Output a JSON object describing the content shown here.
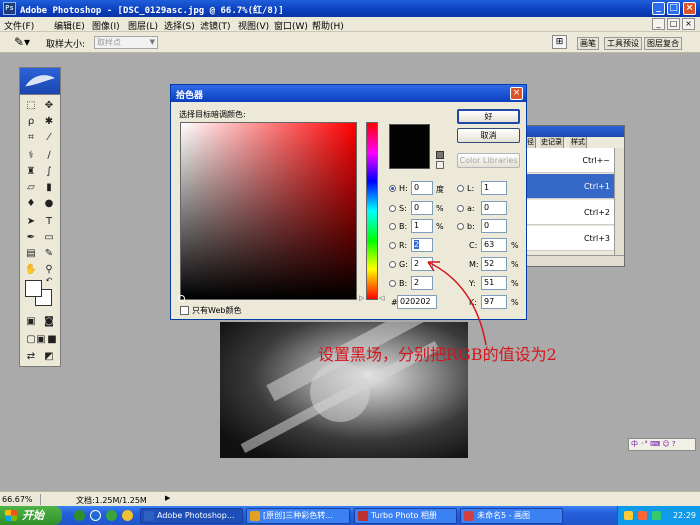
{
  "window": {
    "title": "Adobe Photoshop - [DSC_0129asc.jpg @ 66.7%(红/8)]",
    "app_icon": "Ps",
    "buttons": {
      "minimize": "_",
      "maximize": "□",
      "close": "×"
    }
  },
  "menubar": {
    "items": [
      "文件(F)",
      "编辑(E)",
      "图像(I)",
      "图层(L)",
      "选择(S)",
      "滤镜(T)",
      "视图(V)",
      "窗口(W)",
      "帮助(H)"
    ],
    "doc_buttons": [
      "_",
      "□",
      "×"
    ]
  },
  "options": {
    "tool_icon": "eyedropper-icon",
    "sample_size_label": "取样大小:",
    "sample_size_value": "取样点",
    "palette_tabs": [
      "画笔",
      "工具预设",
      "图层复合"
    ]
  },
  "color_picker": {
    "title": "拾色器",
    "prompt": "选择目标暗调颜色:",
    "buttons": {
      "ok": "好",
      "cancel": "取消",
      "libraries": "Color Libraries"
    },
    "hsb": [
      {
        "label": "H:",
        "value": "0",
        "unit": "度",
        "checked": true
      },
      {
        "label": "S:",
        "value": "0",
        "unit": "%",
        "checked": false
      },
      {
        "label": "B:",
        "value": "1",
        "unit": "%",
        "checked": false
      }
    ],
    "rgb": [
      {
        "label": "R:",
        "value": "2",
        "checked": false,
        "selected": true
      },
      {
        "label": "G:",
        "value": "2",
        "checked": false,
        "selected": false
      },
      {
        "label": "B:",
        "value": "2",
        "checked": false,
        "selected": false
      }
    ],
    "lab": [
      {
        "label": "L:",
        "value": "1",
        "checked": false
      },
      {
        "label": "a:",
        "value": "0",
        "checked": false
      },
      {
        "label": "b:",
        "value": "0",
        "checked": false
      }
    ],
    "cmyk": [
      {
        "label": "C:",
        "value": "63",
        "unit": "%"
      },
      {
        "label": "M:",
        "value": "52",
        "unit": "%"
      },
      {
        "label": "Y:",
        "value": "51",
        "unit": "%"
      },
      {
        "label": "K:",
        "value": "97",
        "unit": "%"
      }
    ],
    "hex_label": "#",
    "hex_value": "020202",
    "web_only_label": "只有Web颜色",
    "selected_color": "#020202",
    "hue_color": "#ff0000"
  },
  "layers_panel": {
    "tabs": [
      "径",
      "史记录",
      "样式"
    ],
    "rows": [
      {
        "shortcut": "Ctrl+~",
        "selected": false
      },
      {
        "shortcut": "Ctrl+1",
        "selected": true
      },
      {
        "shortcut": "Ctrl+2",
        "selected": false
      },
      {
        "shortcut": "Ctrl+3",
        "selected": false
      }
    ]
  },
  "annotation": {
    "text": "设置黑场，分别把RGB的值设为2",
    "color": "#d4151c"
  },
  "ime_bar": "中 ◦° ⌨ ☺ ?",
  "status": {
    "zoom": "66.67%",
    "doc_info": "文档:1.25M/1.25M"
  },
  "taskbar": {
    "start_label": "开始",
    "tasks": [
      {
        "label": "Adobe Photoshop...",
        "active": true,
        "icon_color": "#3060c0"
      },
      {
        "label": "[原创]三种彩色转...",
        "active": false,
        "icon_color": "#e6a020"
      },
      {
        "label": "Turbo Photo 相册",
        "active": false,
        "icon_color": "#c03030"
      },
      {
        "label": "未命名5 - 画图",
        "active": false,
        "icon_color": "#d04040"
      }
    ],
    "clock": "22:29"
  }
}
